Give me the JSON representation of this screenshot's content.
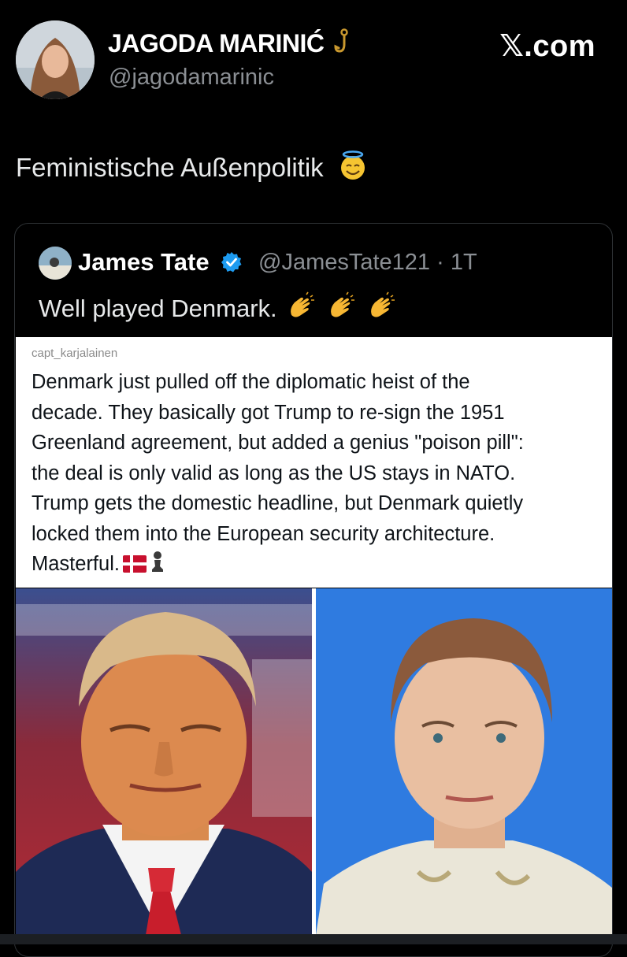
{
  "author": {
    "display_name": "JAGODA MARINIĆ",
    "handle": "@jagodamarinic",
    "name_icon": "hook-icon"
  },
  "brand": "𝕏.com",
  "tweet": {
    "text": "Feministische Außenpolitik",
    "emoji": "smiling-face-with-halo-icon"
  },
  "quote": {
    "name": "James Tate",
    "verified_icon": "verified-badge-icon",
    "handle": "@JamesTate121",
    "separator": "·",
    "time": "1T",
    "text": "Well played Denmark.",
    "emojis": [
      "clapping-hands-icon",
      "clapping-hands-icon",
      "clapping-hands-icon"
    ],
    "embed": {
      "username": "capt_karjalainen",
      "lines": [
        "Denmark just pulled off the diplomatic heist of the",
        "decade. They basically got Trump to re-sign the 1951",
        "Greenland agreement, but added a genius \"poison pill\":",
        "the deal is only valid as long as the US stays in NATO.",
        "Trump gets the domestic headline, but Denmark quietly",
        "locked them into the European security architecture.",
        "Masterful."
      ],
      "trailing_icons": [
        "denmark-flag-icon",
        "chess-pawn-icon"
      ]
    },
    "photos": [
      "photo-man-in-suit-red-tie",
      "photo-woman-blue-background"
    ]
  },
  "colors": {
    "background": "#000000",
    "text": "#e7e9ea",
    "secondary": "#8b8f94",
    "verified": "#1d9bf0",
    "card_border": "#2f3336"
  }
}
